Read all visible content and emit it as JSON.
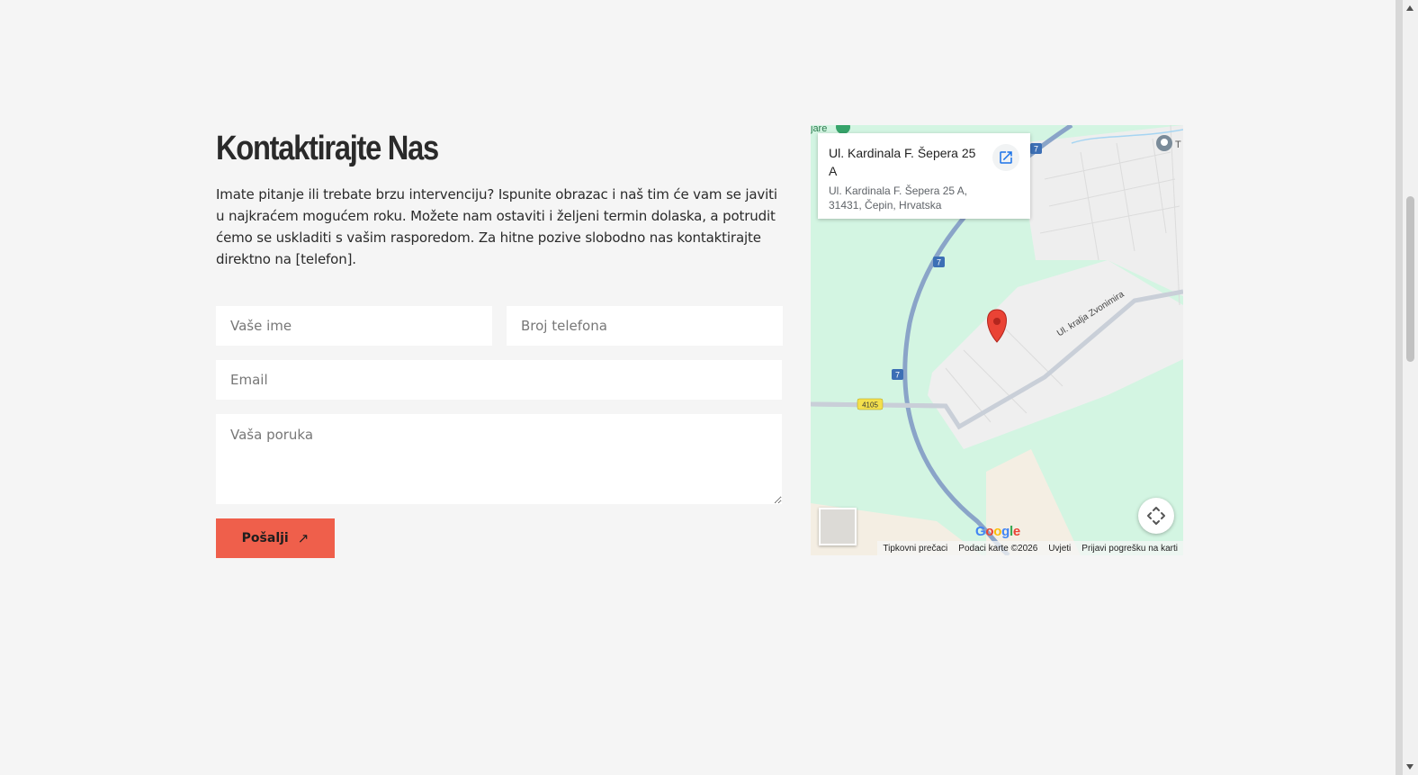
{
  "contact": {
    "title": "Kontaktirajte Nas",
    "intro": "Imate pitanje ili trebate brzu intervenciju? Ispunite obrazac i naš tim će vam se javiti u najkraćem mogućem roku. Možete nam ostaviti i željeni termin dolaska, a potrudit ćemo se uskladiti s vašim rasporedom. Za hitne pozive slobodno nas kontaktirajte direktno na [telefon].",
    "form": {
      "name_placeholder": "Vaše ime",
      "phone_placeholder": "Broj telefona",
      "email_placeholder": "Email",
      "message_placeholder": "Vaša poruka",
      "submit_label": "Pošalji",
      "submit_icon": "arrow-up-right-icon",
      "accent_color": "#ef5f4b"
    }
  },
  "map": {
    "place_title": "Ul. Kardinala F. Šepera 25 A",
    "place_address": "Ul. Kardinala F. Šepera 25 A, 31431, Čepin, Hrvatska",
    "street_label": "Ul. kralja Zvonimira",
    "road_shields": [
      "7",
      "7",
      "7",
      "4105"
    ],
    "top_left_fragment": "jare",
    "top_right_fragment": "T",
    "google_logo": [
      "G",
      "o",
      "o",
      "g",
      "l",
      "e"
    ],
    "footer": {
      "shortcuts": "Tipkovni prečaci",
      "data": "Podaci karte ©2026",
      "terms": "Uvjeti",
      "report": "Prijavi pogrešku na karti"
    },
    "marker_color": "#ea4335"
  }
}
